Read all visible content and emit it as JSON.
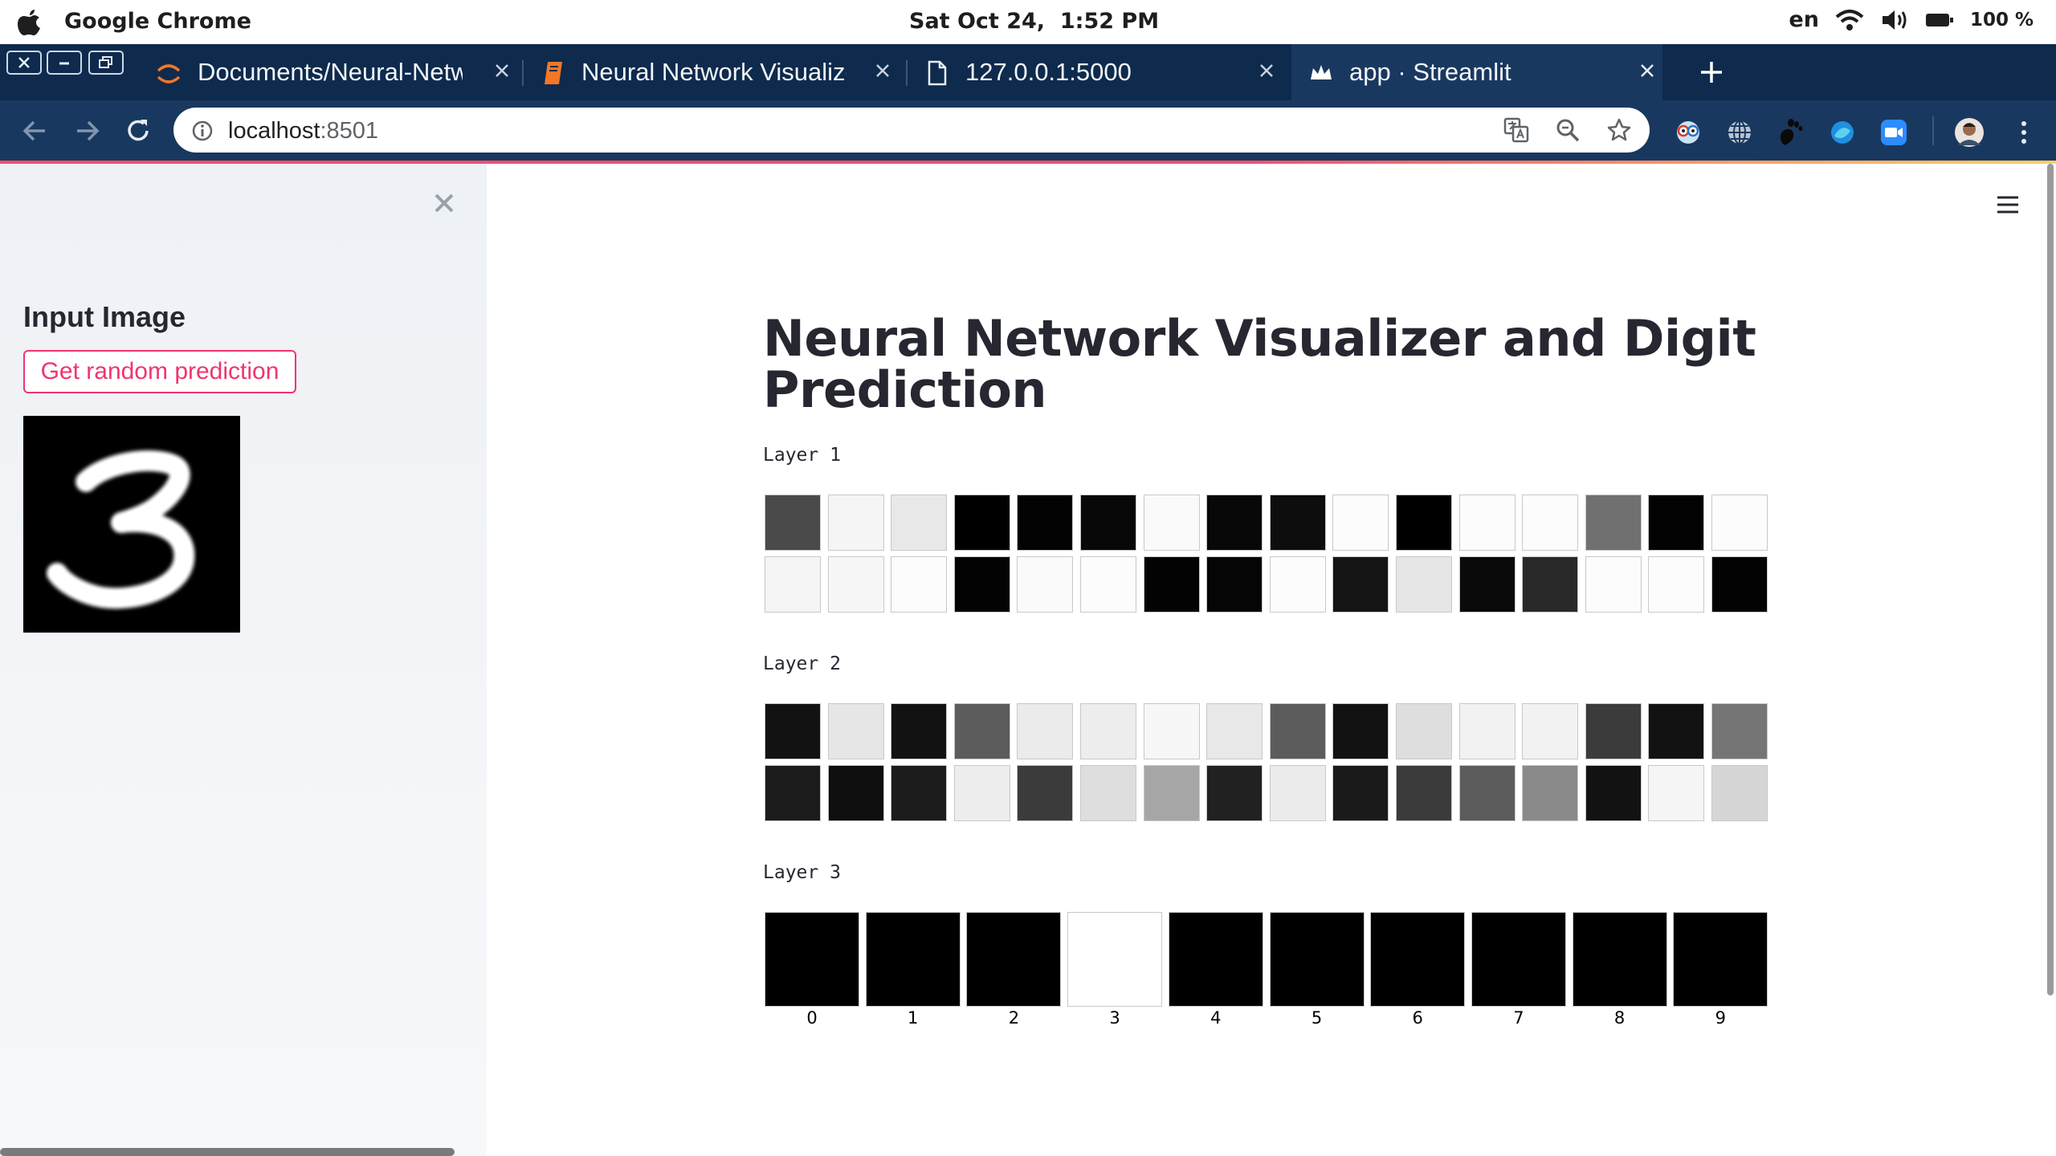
{
  "menubar": {
    "app_name": "Google Chrome",
    "clock": "Sat Oct 24,  1:52 PM",
    "language": "en",
    "battery": "100 %"
  },
  "tabs": [
    {
      "title": "Documents/Neural-Netwo",
      "icon": "jupyter-icon",
      "active": false
    },
    {
      "title": "Neural Network Visualize",
      "icon": "book-icon",
      "active": false
    },
    {
      "title": "127.0.0.1:5000",
      "icon": "page-icon",
      "active": false
    },
    {
      "title": "app · Streamlit",
      "icon": "streamlit-crown-icon",
      "active": true
    }
  ],
  "toolbar": {
    "url_host": "localhost",
    "url_port": ":8501"
  },
  "sidebar": {
    "heading": "Input Image",
    "button_label": "Get random prediction",
    "input_digit": "3"
  },
  "main": {
    "title": "Neural Network Visualizer and Digit Prediction",
    "layers": [
      {
        "label": "Layer 1",
        "rows": [
          [
            0.29,
            0.96,
            0.91,
            0.0,
            0.01,
            0.03,
            0.98,
            0.03,
            0.05,
            0.99,
            0.0,
            0.99,
            0.99,
            0.44,
            0.01,
            0.99
          ],
          [
            0.96,
            0.97,
            0.99,
            0.01,
            0.98,
            0.99,
            0.01,
            0.02,
            0.99,
            0.08,
            0.9,
            0.04,
            0.16,
            0.99,
            0.99,
            0.01
          ]
        ]
      },
      {
        "label": "Layer 2",
        "rows": [
          [
            0.07,
            0.9,
            0.07,
            0.36,
            0.92,
            0.93,
            0.97,
            0.91,
            0.36,
            0.07,
            0.87,
            0.95,
            0.95,
            0.23,
            0.07,
            0.46
          ],
          [
            0.11,
            0.06,
            0.11,
            0.93,
            0.23,
            0.87,
            0.65,
            0.13,
            0.92,
            0.1,
            0.23,
            0.36,
            0.54,
            0.07,
            0.96,
            0.84
          ]
        ]
      },
      {
        "label": "Layer 3",
        "outputs": [
          0.0,
          0.0,
          0.0,
          1.0,
          0.0,
          0.0,
          0.0,
          0.0,
          0.0,
          0.0
        ],
        "output_labels": [
          "0",
          "1",
          "2",
          "3",
          "4",
          "5",
          "6",
          "7",
          "8",
          "9"
        ]
      }
    ]
  }
}
